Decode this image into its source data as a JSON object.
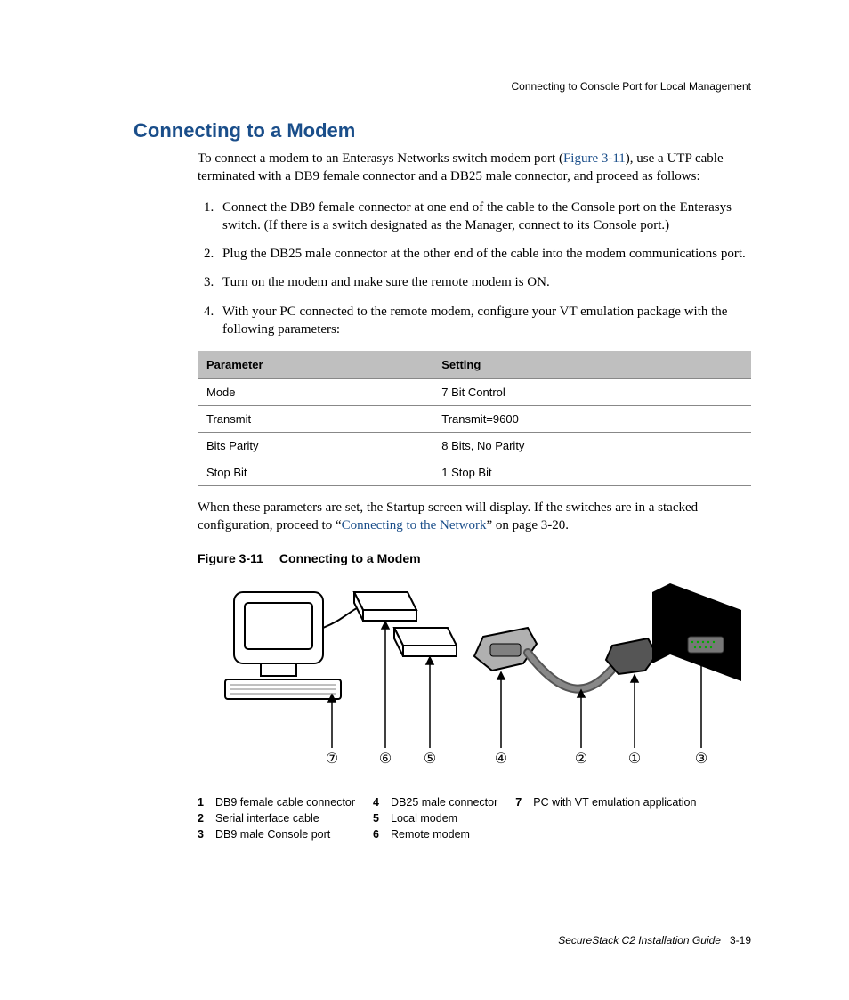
{
  "running_head": "Connecting to Console Port for Local Management",
  "section_title": "Connecting to a Modem",
  "intro_parts": {
    "a": "To connect a modem to an Enterasys Networks switch modem port (",
    "link": "Figure 3-11",
    "b": "), use a UTP cable terminated with a DB9 female connector and a DB25 male connector, and proceed as follows:"
  },
  "steps": [
    "Connect the DB9 female connector at one end of the cable to the Console port on the Enterasys switch. (If there is a switch designated as the Manager, connect to its Console port.)",
    "Plug the DB25 male connector at the other end of the cable into the modem communications port.",
    "Turn on the modem and make sure the remote modem is ON.",
    "With your PC connected to the remote modem, configure your VT emulation package with the following parameters:"
  ],
  "table": {
    "headers": [
      "Parameter",
      "Setting"
    ],
    "rows": [
      [
        "Mode",
        "7 Bit Control"
      ],
      [
        "Transmit",
        "Transmit=9600"
      ],
      [
        "Bits Parity",
        "8 Bits, No Parity"
      ],
      [
        "Stop Bit",
        "1 Stop Bit"
      ]
    ]
  },
  "after_table": {
    "a": "When these parameters are set, the Startup screen will display. If the switches are in a stacked configuration, proceed to “",
    "link": "Connecting to the Network",
    "b": "” on page 3-20."
  },
  "figure_caption": {
    "num": "Figure 3-11",
    "title": "Connecting to a Modem"
  },
  "callouts": [
    "⑦",
    "⑥",
    "⑤",
    "④",
    "②",
    "①",
    "③"
  ],
  "legend": {
    "col1": [
      {
        "n": "1",
        "t": "DB9 female cable connector"
      },
      {
        "n": "2",
        "t": "Serial interface cable"
      },
      {
        "n": "3",
        "t": "DB9 male Console port"
      }
    ],
    "col2": [
      {
        "n": "4",
        "t": "DB25 male connector"
      },
      {
        "n": "5",
        "t": "Local modem"
      },
      {
        "n": "6",
        "t": "Remote modem"
      }
    ],
    "col3": [
      {
        "n": "7",
        "t": "PC with VT emulation application"
      }
    ]
  },
  "footer": {
    "book": "SecureStack C2 Installation Guide",
    "page": "3-19"
  }
}
